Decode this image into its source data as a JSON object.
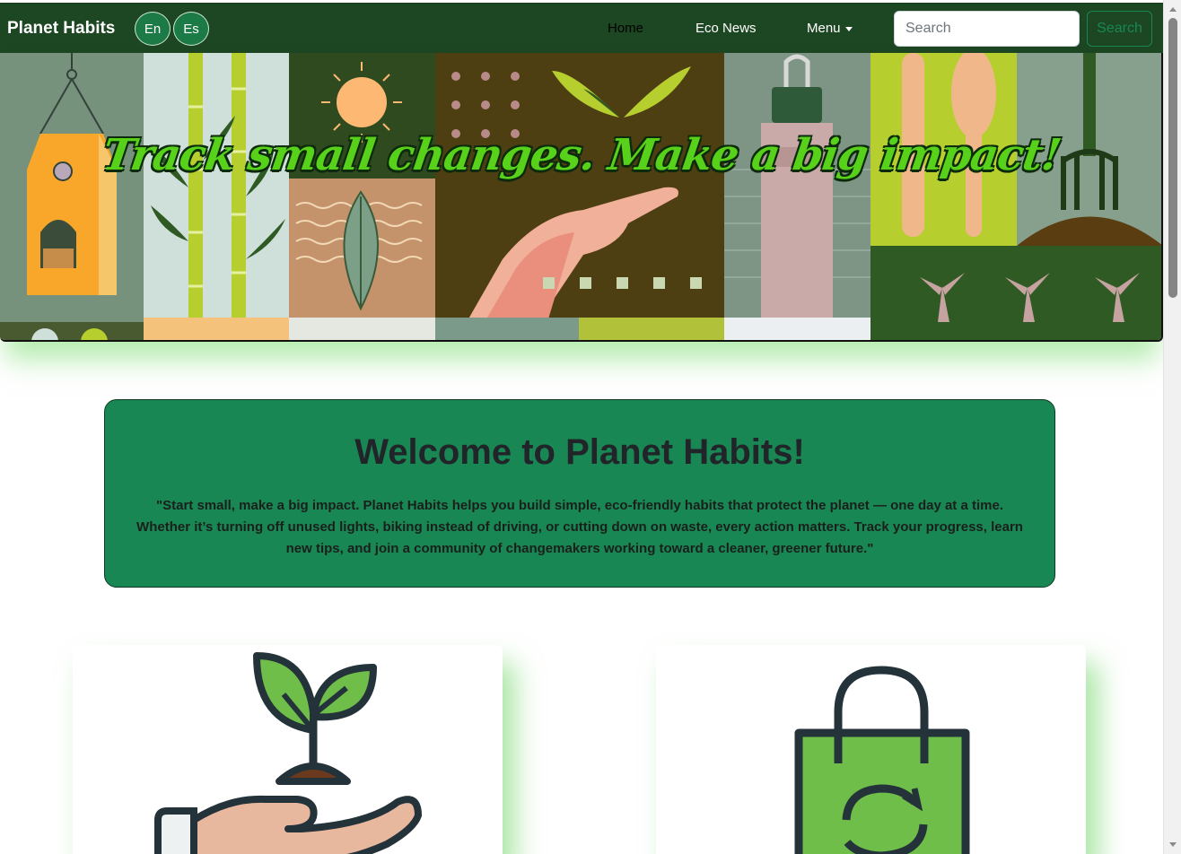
{
  "navbar": {
    "brand": "Planet Habits",
    "languages": [
      "En",
      "Es"
    ],
    "links": {
      "home": "Home",
      "eco_news": "Eco News",
      "menu": "Menu"
    },
    "search": {
      "placeholder": "Search",
      "button": "Search"
    }
  },
  "hero": {
    "title": "Track small changes. Make a big impact!"
  },
  "welcome": {
    "heading": "Welcome to Planet Habits!",
    "text": "\"Start small, make a big impact. Planet Habits helps you build simple, eco-friendly habits that protect the planet — one day at a time. Whether it’s turning off unused lights, biking instead of driving, or cutting down on waste, every action matters. Track your progress, learn new tips, and join a community of changemakers working toward a cleaner, greener future.\""
  },
  "cards": [
    {
      "icon": "plant-in-hand-icon"
    },
    {
      "icon": "recycle-bag-icon"
    }
  ],
  "colors": {
    "navbar": "#1d4622",
    "accent_green": "#198754",
    "hero_title": "#57d11a"
  }
}
